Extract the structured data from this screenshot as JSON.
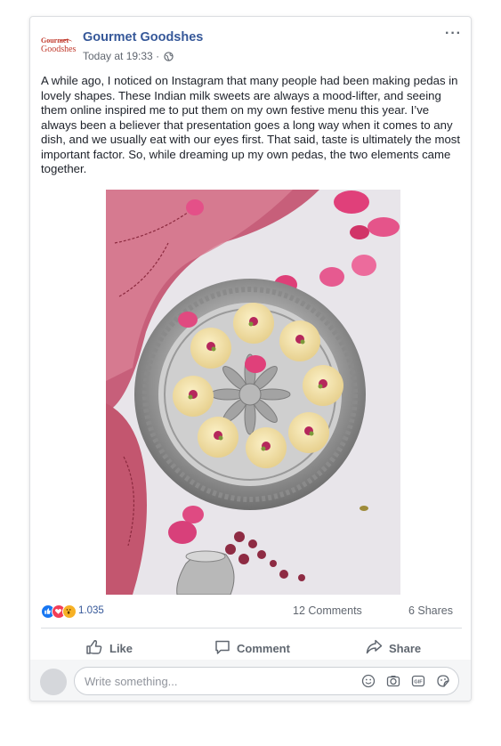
{
  "post": {
    "page_name": "Gourmet Goodshes",
    "logo_line1": "Gourmet",
    "logo_line2": "Goodshes",
    "timestamp": "Today at 19:33",
    "separator": " · ",
    "more_label": "···",
    "audience_icon": "globe-icon",
    "text": "A while ago, I noticed on Instagram that many people had been making pedas in lovely shapes. These Indian milk sweets are always a mood-lifter, and seeing them online inspired me to put them on my own festive menu this year. I’ve always been a believer that presentation goes a long way when it comes to any dish, and we usually eat with our eyes first. That said, taste is ultimately the most important factor. So, while dreaming up my own pedas, the two elements came together."
  },
  "stats": {
    "reaction_count": "1.035",
    "comments": "12 Comments",
    "shares": "6 Shares",
    "reaction_icons": [
      "like-icon",
      "love-icon",
      "wow-icon"
    ]
  },
  "actions": {
    "like": "Like",
    "comment": "Comment",
    "share": "Share"
  },
  "comment_box": {
    "placeholder": "Write something...",
    "icons": [
      "emoji-icon",
      "camera-icon",
      "gif-icon",
      "sticker-icon"
    ]
  },
  "colors": {
    "link_blue": "#365899",
    "like_blue": "#1877f2",
    "love_red": "#f33e58",
    "wow_yellow": "#f7b125"
  }
}
